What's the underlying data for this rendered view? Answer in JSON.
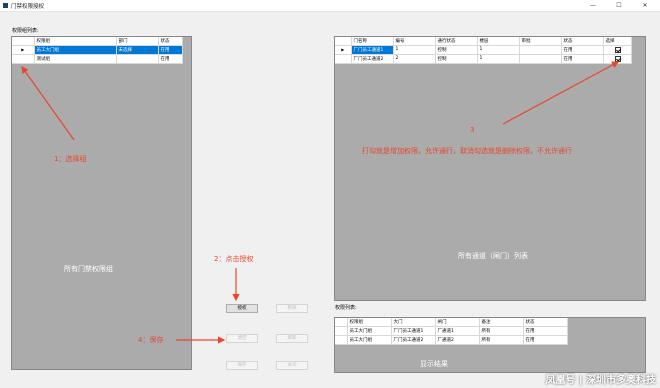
{
  "window": {
    "title": "门禁权限授权",
    "minimize": "—",
    "maximize": "☐",
    "close": "✕"
  },
  "group_panel": {
    "label": "权限组列表:",
    "columns": [
      "权限组",
      "部门",
      "状态"
    ],
    "rows": [
      {
        "indicator": "▶",
        "name": "员工大门组",
        "dept": "未选择",
        "status": "在用",
        "selected": true
      },
      {
        "indicator": "",
        "name": "测试组",
        "dept": "",
        "status": "在用",
        "selected": false
      }
    ]
  },
  "channel_panel": {
    "columns": [
      "门名称",
      "编号",
      "通行状态",
      "楼层",
      "审批",
      "状态",
      "选择"
    ],
    "rows": [
      {
        "indicator": "▶",
        "name": "厂门员工通道1",
        "code": "1",
        "pass": "控制",
        "floor": "1",
        "approve": "",
        "status": "在用",
        "checked": true,
        "selected": true
      },
      {
        "indicator": "",
        "name": "厂门员工通道2",
        "code": "2",
        "pass": "控制",
        "floor": "1",
        "approve": "",
        "status": "在用",
        "checked": true,
        "selected": false
      }
    ]
  },
  "permission_panel": {
    "label": "权限列表:",
    "columns": [
      "权限组",
      "大门",
      "闸门",
      "备注",
      "状态"
    ],
    "rows": [
      {
        "group": "员工大门组",
        "gate": "厂门员工通道1",
        "door": "厂通道1",
        "note": "所有",
        "status": "在用"
      },
      {
        "group": "员工大门组",
        "gate": "厂门员工通道2",
        "door": "厂通道2",
        "note": "所有",
        "status": "在用"
      }
    ]
  },
  "buttons": {
    "authorize": "授权",
    "revoke": "移除",
    "b3": "清空",
    "b4": "刷新",
    "b5": "保存",
    "b6": "关闭"
  },
  "annotations": {
    "select_group": "1：选择组",
    "all_groups": "所有门禁权限组",
    "click_authorize": "2：点击授权",
    "save": "4：保存",
    "step3_num": "3",
    "step3_text": "打勾就是增加权限，允许通行，取消勾选就是删除权限，不允许通行",
    "all_channels": "所有通道（闸门）列表",
    "show_result": "显示结果"
  },
  "watermark": "凤凰号 | 深圳市多奥科技",
  "colors": {
    "annotation": "#e8462f",
    "selection": "#0078d7",
    "grid_bg": "#ababab"
  }
}
